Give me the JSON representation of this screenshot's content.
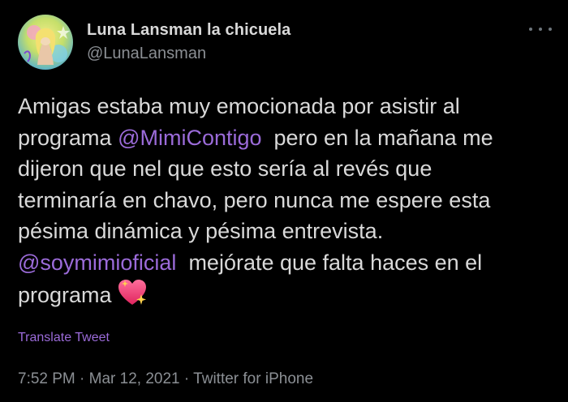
{
  "author": {
    "display_name": "Luna Lansman la chicuela",
    "handle": "@LunaLansman",
    "avatar_icon": "profile-avatar"
  },
  "more_icon": "more-horizontal-icon",
  "tweet": {
    "lines": [
      [
        {
          "text": "Amigas estaba muy emocionada por asistir al"
        }
      ],
      [
        {
          "text": "programa "
        },
        {
          "text": "@MimiContigo",
          "mention": true
        },
        {
          "text": "  pero en la mañana me"
        }
      ],
      [
        {
          "text": "dijeron que nel que esto sería al revés que"
        }
      ],
      [
        {
          "text": "terminaría en chavo, pero nunca me espere esta"
        }
      ],
      [
        {
          "text": "pésima dinámica y pésima entrevista."
        }
      ],
      [
        {
          "text": "@soymimioficial",
          "mention": true
        },
        {
          "text": "  mejórate que falta haces en el"
        }
      ],
      [
        {
          "text": "programa"
        }
      ]
    ],
    "emoji": "sparkling-heart-emoji",
    "translate_label": "Translate Tweet"
  },
  "meta": {
    "time": "7:52 PM",
    "date": "Mar 12, 2021",
    "source": "Twitter for iPhone",
    "separator": " · "
  },
  "colors": {
    "background": "#000000",
    "text": "#d9d9d9",
    "secondary": "#8b8f94",
    "accent": "#9b6bd9"
  }
}
